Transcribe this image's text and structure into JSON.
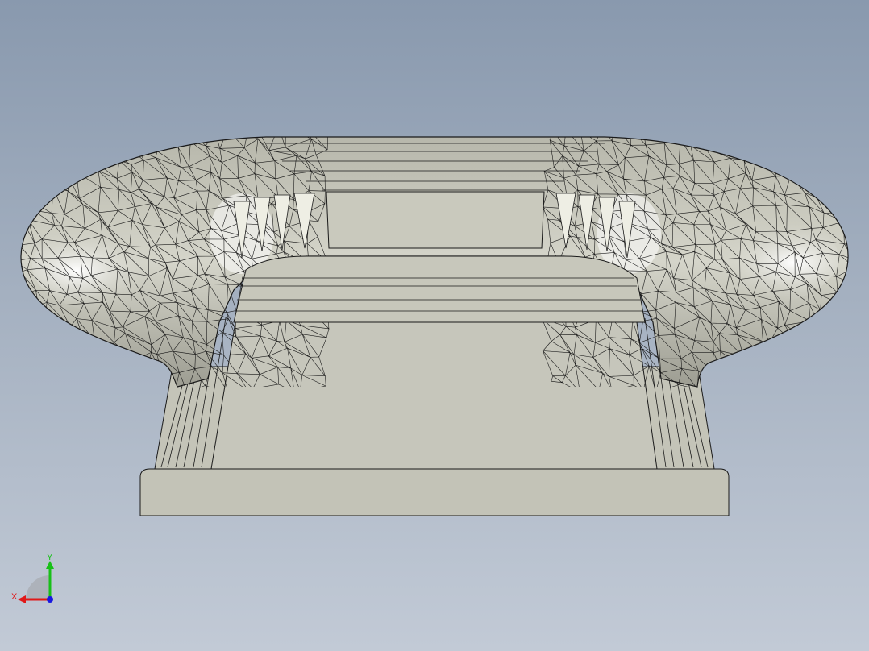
{
  "viewport": {
    "background_top": "#8999ae",
    "background_bottom": "#c2cad6"
  },
  "model": {
    "body_color": "#c8c8bc",
    "body_shadow": "#a9a99d",
    "highlight_color": "#f7f7ee",
    "edge_color": "#1a1a1a"
  },
  "triad": {
    "x_label": "X",
    "y_label": "Y",
    "x_color": "#e01818",
    "y_color": "#18c018",
    "z_color": "#1818e0"
  }
}
